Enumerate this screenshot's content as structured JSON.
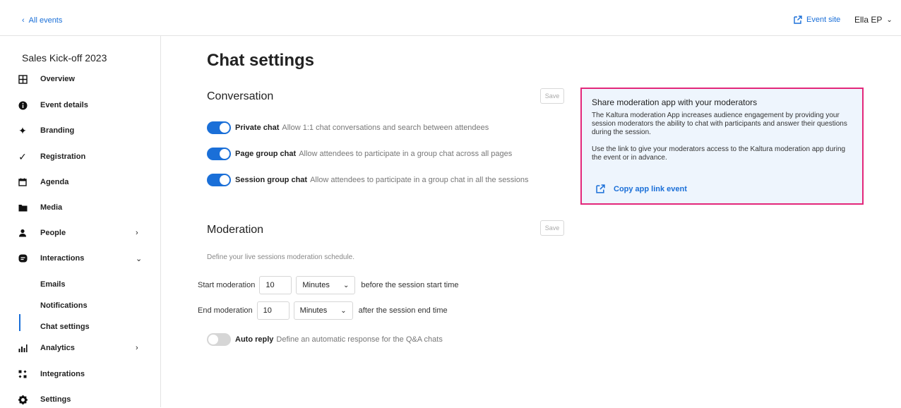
{
  "header": {
    "back_label": "All events",
    "event_site_label": "Event site",
    "user_name": "Ella EP"
  },
  "sidebar": {
    "event_name": "Sales Kick-off 2023",
    "items": [
      {
        "label": "Overview",
        "icon": "grid-icon"
      },
      {
        "label": "Event details",
        "icon": "info-icon"
      },
      {
        "label": "Branding",
        "icon": "sparkle-icon"
      },
      {
        "label": "Registration",
        "icon": "check-icon"
      },
      {
        "label": "Agenda",
        "icon": "calendar-icon"
      },
      {
        "label": "Media",
        "icon": "folder-icon"
      },
      {
        "label": "People",
        "icon": "person-icon"
      },
      {
        "label": "Interactions",
        "icon": "chat-icon"
      },
      {
        "label": "Analytics",
        "icon": "bar-chart-icon"
      },
      {
        "label": "Integrations",
        "icon": "integrations-icon"
      },
      {
        "label": "Settings",
        "icon": "gear-icon"
      }
    ],
    "sub_items": [
      "Emails",
      "Notifications",
      "Chat settings"
    ]
  },
  "main": {
    "title": "Chat settings",
    "conversation": {
      "title": "Conversation",
      "save_label": "Save",
      "toggles": [
        {
          "label": "Private chat",
          "desc": "Allow 1:1 chat conversations and search between attendees",
          "on": true
        },
        {
          "label": "Page group chat",
          "desc": "Allow attendees to participate in a group chat across all pages",
          "on": true
        },
        {
          "label": "Session group chat",
          "desc": "Allow attendees to participate in a group chat in all the sessions",
          "on": true
        }
      ]
    },
    "moderation": {
      "title": "Moderation",
      "save_label": "Save",
      "desc": "Define your live sessions moderation schedule.",
      "start_label": "Start moderation",
      "start_value": "10",
      "start_unit": "Minutes",
      "start_suffix": "before the session start time",
      "end_label": "End moderation",
      "end_value": "10",
      "end_unit": "Minutes",
      "end_suffix": "after the session end time",
      "auto_reply_label": "Auto reply",
      "auto_reply_desc": "Define an automatic response for the Q&A chats",
      "auto_reply_on": false
    }
  },
  "card": {
    "title": "Share moderation app with your moderators",
    "p1": "The Kaltura moderation App increases audience engagement by providing your session moderators the ability to chat with participants and answer their questions during the session.",
    "p2": "Use the link to give your moderators access to the Kaltura moderation app during the event or in advance.",
    "link_label": "Copy app link event",
    "border_color": "#e3277a",
    "background": "#eef5fd"
  },
  "colors": {
    "accent": "#1a6fd8"
  }
}
